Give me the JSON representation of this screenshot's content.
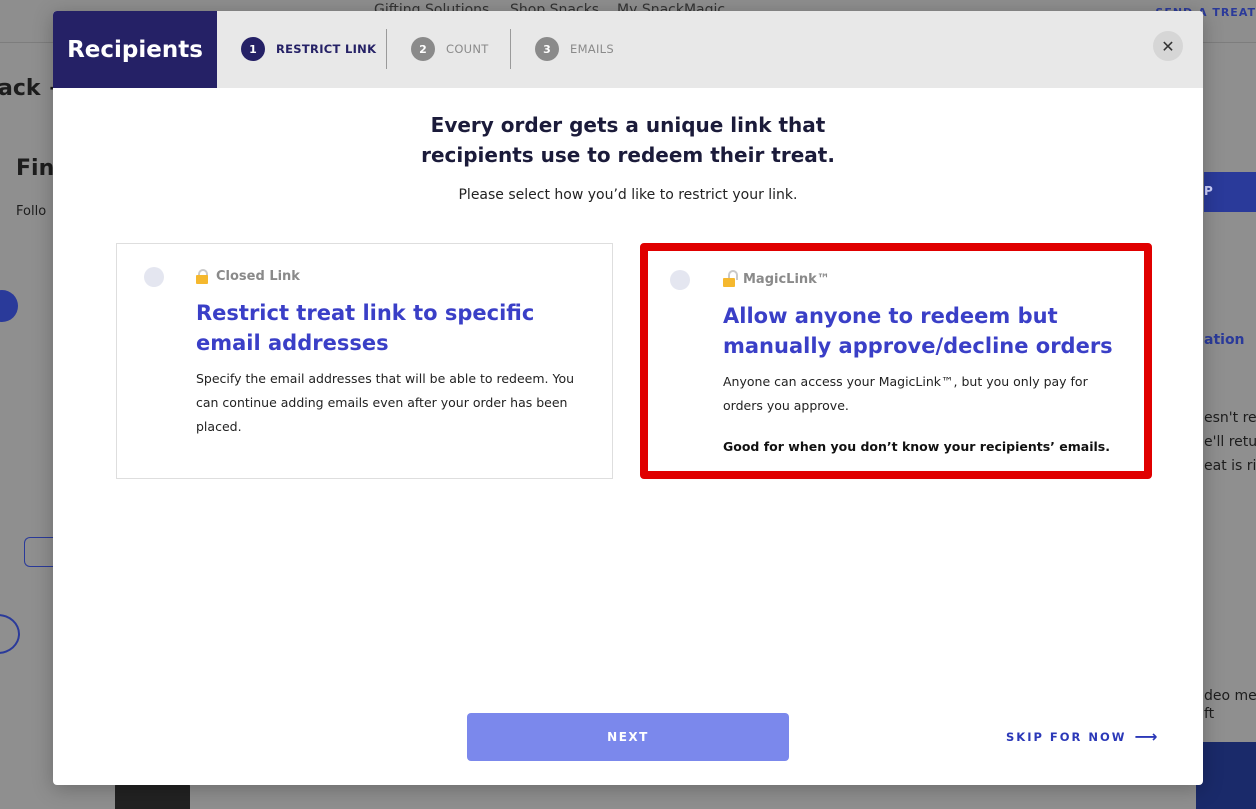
{
  "background": {
    "nav": [
      "Gifting Solutions",
      "Shop Snacks",
      "My SnackMagic"
    ],
    "nav_cta": "SEND A TREAT",
    "left_texts": [
      "ack +",
      "Fin",
      "Follo"
    ],
    "right_texts": [
      "ation",
      "esn't rec",
      "e'll retu",
      "eat is ris",
      "deo mes",
      "ft"
    ],
    "right_button": "P"
  },
  "modal": {
    "title": "Recipients",
    "steps": [
      {
        "num": "1",
        "label": "RESTRICT LINK"
      },
      {
        "num": "2",
        "label": "COUNT"
      },
      {
        "num": "3",
        "label": "EMAILS"
      }
    ],
    "close_icon": "✕",
    "headline_line1": "Every order gets a unique link that",
    "headline_line2": "recipients use to redeem their treat.",
    "subline": "Please select how you’d like to restrict your link.",
    "options": [
      {
        "tag": "Closed Link",
        "title": "Restrict treat link to specific email addresses",
        "description": "Specify the email addresses that will be able to redeem. You can continue adding emails even after your order has been placed.",
        "note": "",
        "icon": "closed-lock-icon"
      },
      {
        "tag": "MagicLink™",
        "title": "Allow anyone to redeem but manually approve/decline orders",
        "description": "Anyone can access your MagicLink™, but you only pay for orders you approve.",
        "note": "Good for when you don’t know your recipients’ emails.",
        "icon": "open-lock-icon",
        "highlight_color": "#e00000"
      }
    ],
    "next_label": "NEXT",
    "skip_label": "SKIP FOR NOW",
    "skip_arrow": "⟶"
  },
  "colors": {
    "brand_dark": "#252166",
    "accent_blue": "#3a3fc7",
    "next_button": "#7b88ec",
    "highlight": "#e00000"
  }
}
